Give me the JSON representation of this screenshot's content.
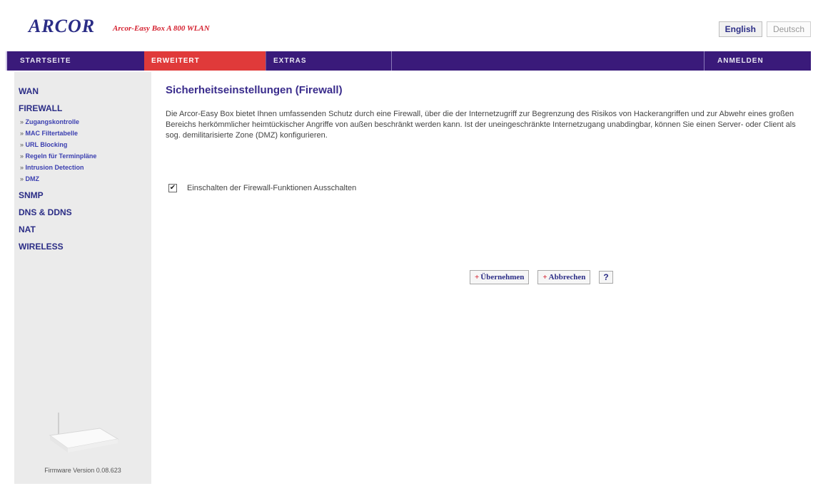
{
  "header": {
    "logo_text": "ARCOR",
    "subtitle": "Arcor-Easy Box A 800 WLAN",
    "lang_english": "English",
    "lang_deutsch": "Deutsch"
  },
  "nav": {
    "startseite": "STARTSEITE",
    "erweitert": "ERWEITERT",
    "extras": "EXTRAS",
    "anmelden": "ANMELDEN"
  },
  "sidebar": {
    "wan": "WAN",
    "firewall": "FIREWALL",
    "sub_items": [
      "Zugangskontrolle",
      "MAC Filtertabelle",
      "URL Blocking",
      "Regeln für Terminpläne",
      "Intrusion Detection",
      "DMZ"
    ],
    "snmp": "SNMP",
    "dns_ddns": "DNS & DDNS",
    "nat": "NAT",
    "wireless": "WIRELESS",
    "firmware": "Firmware Version 0.08.623"
  },
  "main": {
    "title": "Sicherheitseinstellungen (Firewall)",
    "description": "Die Arcor-Easy Box bietet Ihnen umfassenden Schutz durch eine Firewall, über die der Internetzugriff zur Begrenzung des Risikos von Hackerangriffen und zur Abwehr eines großen Bereichs herkömmlicher heimtückischer Angriffe von außen beschränkt werden kann. Ist der uneingeschränkte Internetzugang unabdingbar, können Sie einen Server- oder Client als sog. demilitarisierte Zone (DMZ) konfigurieren.",
    "checkbox_label": "Einschalten der Firewall-Funktionen Ausschalten",
    "checkbox_checked": true,
    "apply_label": "Übernehmen",
    "cancel_label": "Abbrechen",
    "help_label": "?"
  },
  "colors": {
    "nav_bg": "#3a1a7a",
    "nav_active": "#e03a3a",
    "brand_blue": "#2b2d86",
    "brand_red": "#d4202f",
    "sidebar_bg": "#ebebeb"
  }
}
